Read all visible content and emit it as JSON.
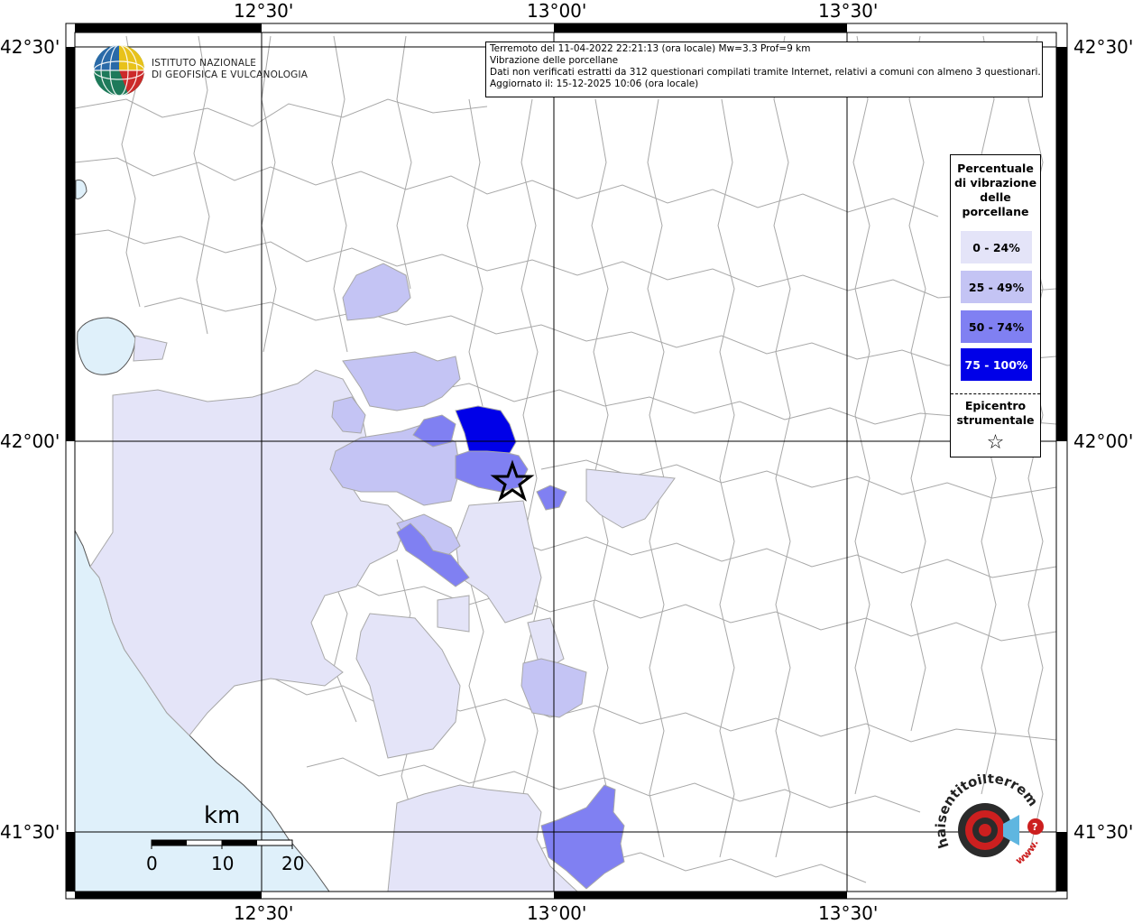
{
  "frame": {
    "top_labels": [
      "12°30'",
      "13°00'",
      "13°30'"
    ],
    "bottom_labels": [
      "12°30'",
      "13°00'",
      "13°30'"
    ],
    "left_labels": [
      "42°30'",
      "42°00'",
      "41°30'"
    ],
    "right_labels": [
      "42°30'",
      "42°00'",
      "41°30'"
    ]
  },
  "info": {
    "line1": "Terremoto del 11-04-2022 22:21:13 (ora locale) Mw=3.3 Prof=9 km",
    "line2": "Vibrazione delle porcellane",
    "line3": "Dati non verificati estratti da 312 questionari compilati tramite Internet, relativi a comuni con almeno 3 questionari.",
    "line4": "Aggiornato il: 15-12-2025 10:06 (ora locale)"
  },
  "logo": {
    "line1": "ISTITUTO NAZIONALE",
    "line2": "DI GEOFISICA E VULCANOLOGIA"
  },
  "legend": {
    "title": [
      "Percentuale",
      "di vibrazione",
      "delle",
      "porcellane"
    ],
    "classes": [
      {
        "label": "0 - 24%",
        "color": "#e4e4f8",
        "text_color": "#000000"
      },
      {
        "label": "25 - 49%",
        "color": "#c4c4f4",
        "text_color": "#000000"
      },
      {
        "label": "50 - 74%",
        "color": "#8080f2",
        "text_color": "#000000"
      },
      {
        "label": "75 - 100%",
        "color": "#0000e8",
        "text_color": "#ffffff"
      }
    ],
    "epicenter": [
      "Epicentro",
      "strumentale"
    ],
    "star": "☆"
  },
  "scale": {
    "unit": "km",
    "ticks": [
      "0",
      "10",
      "20"
    ]
  },
  "colors": {
    "sea": "#dff0fa",
    "boundary": "#a8a8a8",
    "grid": "#000000"
  },
  "hai_logo": {
    "text": "haisentitoilterremoto.it",
    "url_text": "www."
  }
}
